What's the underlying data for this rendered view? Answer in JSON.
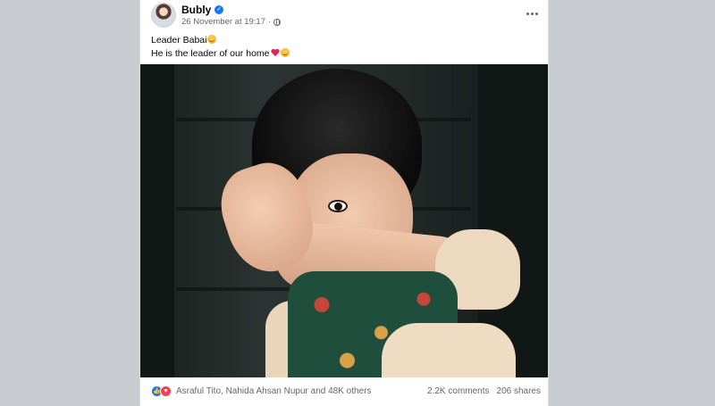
{
  "post": {
    "author": "Bubly",
    "timestamp": "26 November at 19:17",
    "text_line_1": "Leader Babai",
    "text_line_2": "He is the leader of our home",
    "reactors": "Asraful Tito, Nahida Ahsan Nupur and 48K others",
    "comments": "2.2K comments",
    "shares": "206 shares"
  },
  "icons": {
    "verified": "verified-badge-icon",
    "privacy": "globe-icon",
    "more": "more-options-icon",
    "reactions": [
      "like-icon",
      "love-icon"
    ],
    "emojis": [
      "kissing-face-emoji",
      "red-heart-emoji",
      "smiling-face-emoji"
    ]
  },
  "colors": {
    "background": "#c9ccd1",
    "card": "#ffffff",
    "verified": "#1877f2",
    "like": "#1877f2",
    "love": "#f33e58",
    "secondary_text": "#65676b"
  }
}
